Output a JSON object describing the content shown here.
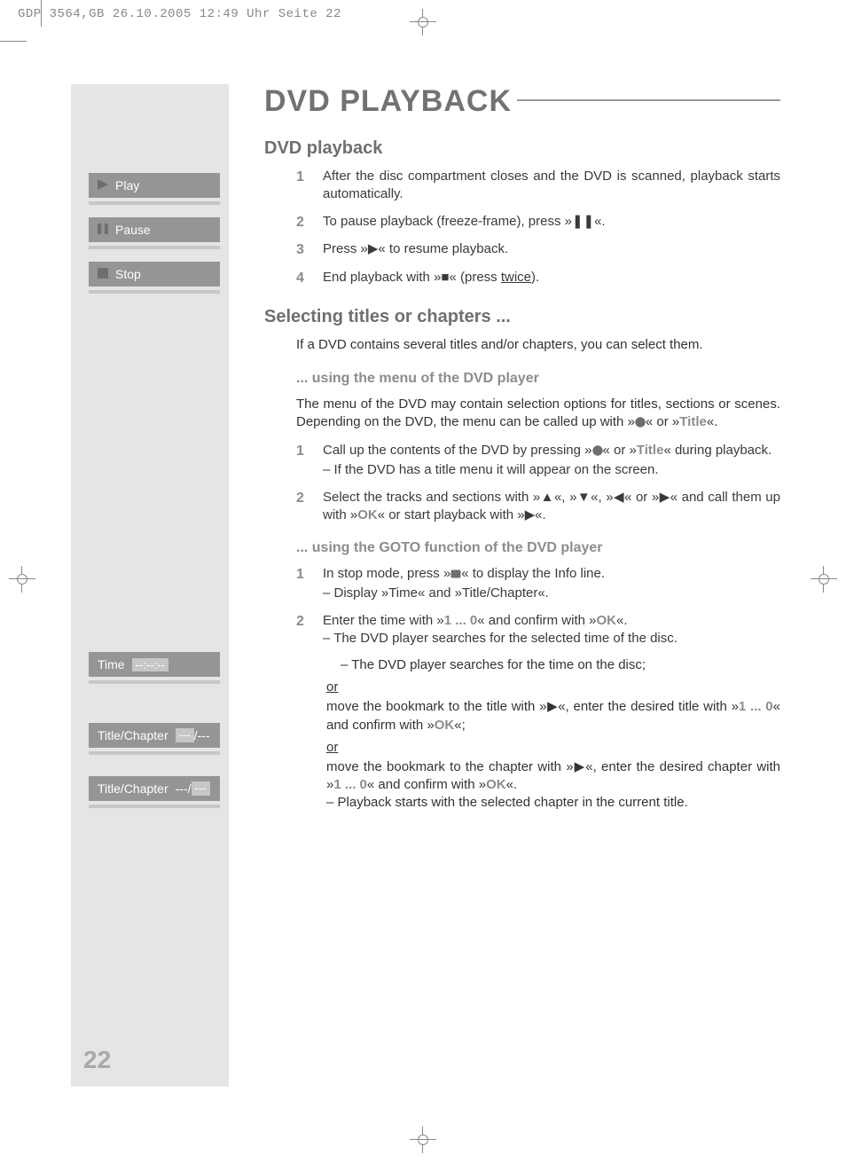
{
  "print_header": "GDP 3564,GB  26.10.2005  12:49 Uhr  Seite 22",
  "page_number": "22",
  "sidebar": {
    "buttons": [
      {
        "label": "Play",
        "icon": "play"
      },
      {
        "label": "Pause",
        "icon": "pause"
      },
      {
        "label": "Stop",
        "icon": "stop"
      }
    ],
    "info": {
      "time_label": "Time",
      "time_value": "--:--:--",
      "tc1_label": "Title/Chapter",
      "tc1_v1": "---",
      "tc1_sep": " / ",
      "tc1_v2": "---",
      "tc2_label": "Title/Chapter",
      "tc2_v1": "---",
      "tc2_sep": " / ",
      "tc2_v2": "---"
    }
  },
  "title_main": "DVD PLAYBACK",
  "sec1_title": "DVD playback",
  "sec1_items": [
    "After the disc compartment closes and the DVD is scanned, playback starts automatically.",
    "To pause playback (freeze-frame), press »❚❚«.",
    "Press »▶« to resume playback.",
    "End playback with »■« (press "
  ],
  "sec1_item4_tail": "twice",
  "sec1_item4_close": ").",
  "sec2_title": "Selecting titles or chapters ...",
  "sec2_intro": "If a DVD contains several titles and/or chapters, you can select them.",
  "sec2a_title": "... using the menu of the DVD player",
  "sec2a_intro_a": "The menu of the DVD may contain selection options for titles, sections or scenes. Depending on the DVD, the menu can be called up with »",
  "sec2a_intro_b": "«  or »",
  "sec2a_intro_title_word": "Title",
  "sec2a_intro_c": "«.",
  "sec2a_items": {
    "i1_a": "Call up the contents of the DVD by pressing »",
    "i1_b": "«  or »",
    "i1_title": "Title",
    "i1_c": "« during playback.",
    "i1_note": "– If the DVD has a title menu it will appear on the screen.",
    "i2_a": "Select the tracks and sections with »▲«, »▼«, »◀« or »▶« and call them up with »",
    "i2_ok": "OK",
    "i2_b": "« or start playback with »▶«."
  },
  "sec2b_title": "... using the GOTO function of the DVD player",
  "sec2b": {
    "i1_a": "In stop mode, press »",
    "i1_b": "« to display the Info line.",
    "i1_note": "– Display »Time« and »Title/Chapter«.",
    "i2_a": "Enter the time with »",
    "i2_digits": "1 ... 0",
    "i2_b": "« and confirm with »",
    "i2_ok": "OK",
    "i2_c": "«.",
    "i2_note1": "– The DVD player searches for the selected time of the disc.",
    "i2_note2": "– The DVD player searches for the time on the disc;",
    "or": "or",
    "alt1_a": "move the bookmark to the title with »▶«, enter the desired title with »",
    "alt1_digits": "1 ... 0",
    "alt1_b": "« and confirm with »",
    "alt1_ok": "OK",
    "alt1_c": "«;",
    "alt2_a": "move the bookmark to the chapter with »▶«, enter the desired chapter with »",
    "alt2_digits": "1 ... 0",
    "alt2_b": "« and confirm with »",
    "alt2_ok": "OK",
    "alt2_c": "«.",
    "alt2_note": "– Playback starts with the selected chapter in the current title."
  }
}
